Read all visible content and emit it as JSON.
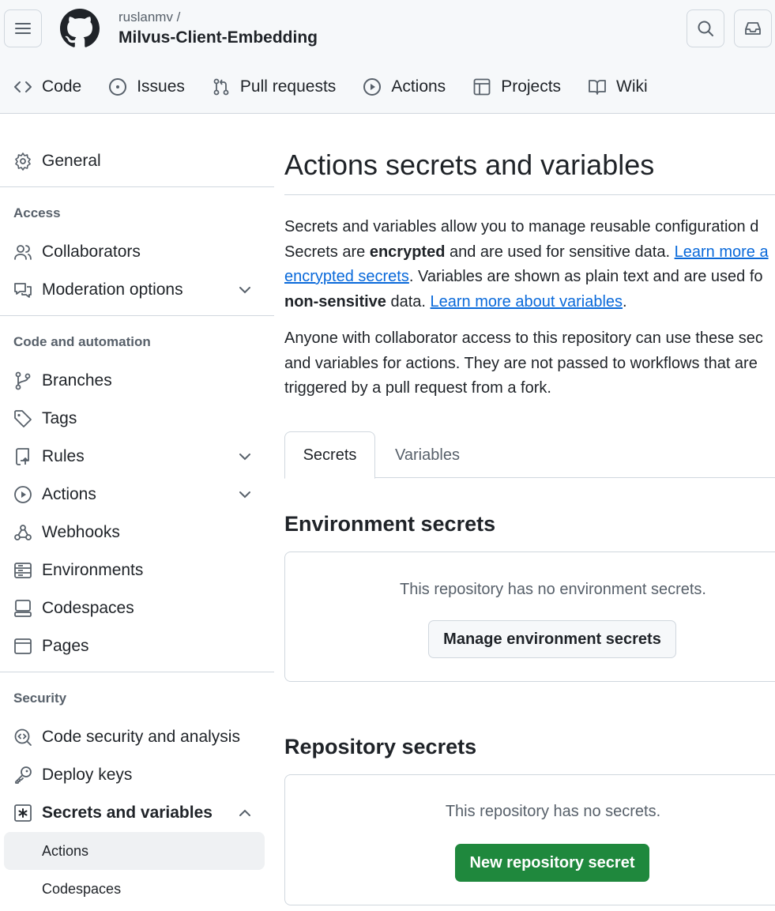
{
  "header": {
    "owner": "ruslanmv /",
    "repo": "Milvus-Client-Embedding"
  },
  "repo_tabs": [
    {
      "label": "Code",
      "icon": "code-icon"
    },
    {
      "label": "Issues",
      "icon": "issue-icon"
    },
    {
      "label": "Pull requests",
      "icon": "pull-request-icon"
    },
    {
      "label": "Actions",
      "icon": "play-icon"
    },
    {
      "label": "Projects",
      "icon": "table-icon"
    },
    {
      "label": "Wiki",
      "icon": "book-icon"
    }
  ],
  "sidebar": {
    "general": "General",
    "access_heading": "Access",
    "collaborators": "Collaborators",
    "moderation": "Moderation options",
    "code_heading": "Code and automation",
    "branches": "Branches",
    "tags": "Tags",
    "rules": "Rules",
    "actions": "Actions",
    "webhooks": "Webhooks",
    "environments": "Environments",
    "codespaces": "Codespaces",
    "pages": "Pages",
    "security_heading": "Security",
    "code_security": "Code security and analysis",
    "deploy_keys": "Deploy keys",
    "secrets_vars": "Secrets and variables",
    "sub_actions": "Actions",
    "sub_codespaces": "Codespaces"
  },
  "main": {
    "title": "Actions secrets and variables",
    "p1_line1": "Secrets and variables allow you to manage reusable configuration d",
    "p1_line2_a": "Secrets are ",
    "p1_line2_b": "encrypted",
    "p1_line2_c": " and are used for sensitive data. ",
    "p1_link1_a": "Learn more a",
    "p1_link1_b": "encrypted secrets",
    "p1_line3_c": ". Variables are shown as plain text and are used fo",
    "p1_line4_a": "non-sensitive",
    "p1_line4_b": " data. ",
    "p1_link2": "Learn more about variables",
    "p1_line4_c": ".",
    "p2_line1": "Anyone with collaborator access to this repository can use these sec",
    "p2_line2": "and variables for actions. They are not passed to workflows that are",
    "p2_line3": "triggered by a pull request from a fork.",
    "tab_secrets": "Secrets",
    "tab_variables": "Variables",
    "env_heading": "Environment secrets",
    "env_empty": "This repository has no environment secrets.",
    "env_button": "Manage environment secrets",
    "repo_heading": "Repository secrets",
    "repo_empty": "This repository has no secrets.",
    "repo_button": "New repository secret"
  },
  "colors": {
    "primary_button": "#1f883d",
    "link": "#0969da",
    "border": "#d0d7de",
    "header_bg": "#f6f8fa"
  }
}
